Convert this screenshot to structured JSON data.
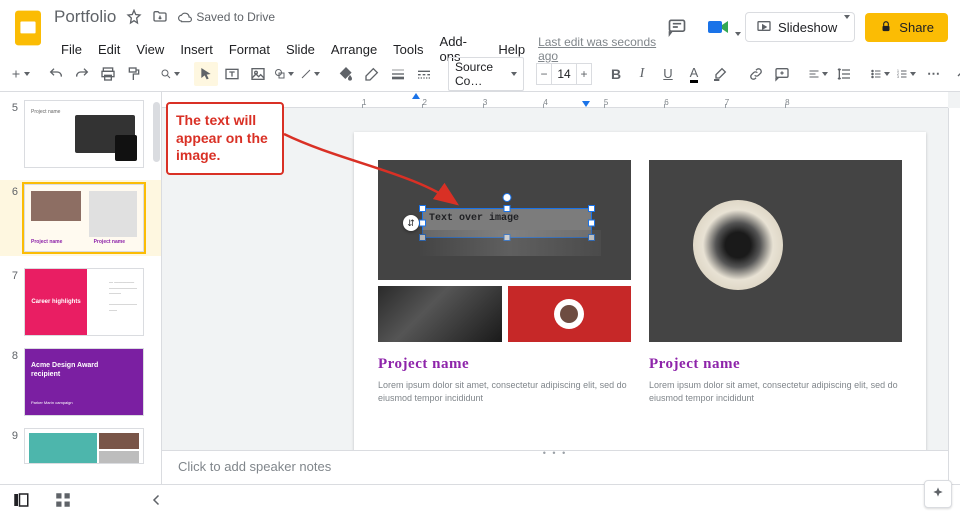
{
  "header": {
    "doc_title": "Portfolio",
    "saved_status": "Saved to Drive",
    "last_edit": "Last edit was seconds ago"
  },
  "menu": [
    "File",
    "Edit",
    "View",
    "Insert",
    "Format",
    "Slide",
    "Arrange",
    "Tools",
    "Add-ons",
    "Help"
  ],
  "top_buttons": {
    "slideshow": "Slideshow",
    "share": "Share"
  },
  "toolbar": {
    "font_name": "Source Co…",
    "font_size": "14"
  },
  "ruler_labels": [
    "1",
    "2",
    "3",
    "4",
    "5",
    "6",
    "7",
    "8"
  ],
  "thumbs": {
    "5": {
      "label": "Project name"
    },
    "6": {
      "cap1": "Project name",
      "cap2": "Project name"
    },
    "7": {
      "title": "Career highlights",
      "lines": "At director\n————\n————\n————"
    },
    "8": {
      "title": "Acme Design Award recipient",
      "sub": "Parker Marín campaign"
    },
    "numbers": [
      "5",
      "6",
      "7",
      "8",
      "9"
    ]
  },
  "callout_text": "The text will appear on the image.",
  "selected_textbox_text": "Text over image",
  "slide": {
    "proj1": {
      "title": "Project name",
      "desc": "Lorem ipsum dolor sit amet, consectetur adipiscing elit, sed do eiusmod tempor incididunt"
    },
    "proj2": {
      "title": "Project name",
      "desc": "Lorem ipsum dolor sit amet, consectetur adipiscing elit, sed do eiusmod tempor incididunt"
    }
  },
  "notes_placeholder": "Click to add speaker notes"
}
